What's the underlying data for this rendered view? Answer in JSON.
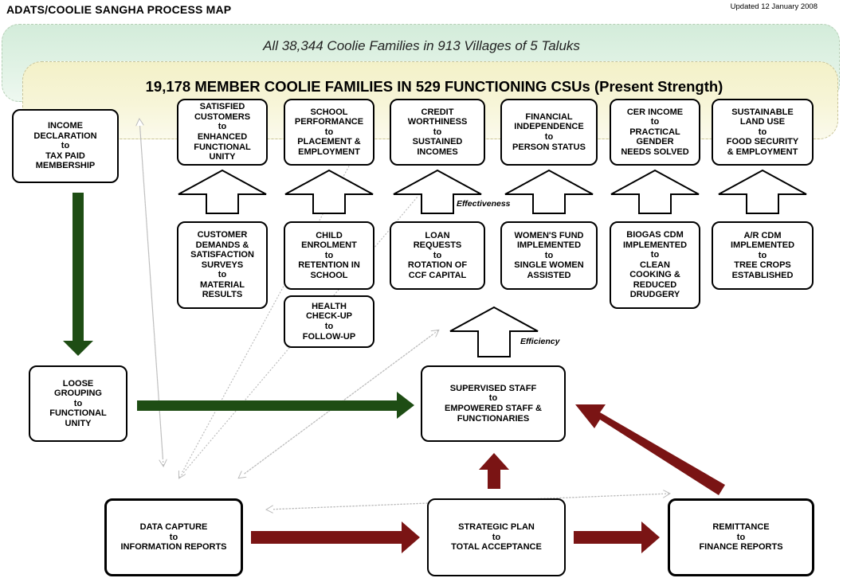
{
  "header": {
    "title": "ADATS/COOLIE SANGHA PROCESS MAP",
    "updated": "Updated 12 January 2008"
  },
  "bands": {
    "outer": "All 38,344 Coolie Families in 913 Villages of 5 Taluks",
    "inner": "19,178 MEMBER COOLIE FAMILIES IN 529 FUNCTIONING CSUs (Present Strength)"
  },
  "colors": {
    "green_arrow": "#1e4d14",
    "red_arrow": "#7a1414",
    "outer_band": "#d9efdf",
    "inner_band": "#f5f3d0"
  },
  "outcomes": [
    "SATISFIED\nCUSTOMERS\nto\nENHANCED\nFUNCTIONAL\nUNITY",
    "SCHOOL\nPERFORMANCE\nto\nPLACEMENT &\nEMPLOYMENT",
    "CREDIT\nWORTHINESS\nto\nSUSTAINED\nINCOMES",
    "FINANCIAL\nINDEPENDENCE\nto\nPERSON STATUS",
    "CER INCOME\nto\nPRACTICAL\nGENDER\nNEEDS SOLVED",
    "SUSTAINABLE\nLAND USE\nto\nFOOD SECURITY\n& EMPLOYMENT"
  ],
  "activities": [
    "CUSTOMER\nDEMANDS &\nSATISFACTION\nSURVEYS\nto\nMATERIAL\nRESULTS",
    "CHILD\nENROLMENT\nto\nRETENTION IN\nSCHOOL",
    "LOAN\nREQUESTS\nto\nROTATION OF\nCCF CAPITAL",
    "WOMEN'S FUND\nIMPLEMENTED\nto\nSINGLE WOMEN\nASSISTED",
    "BIOGAS CDM\nIMPLEMENTED\nto\nCLEAN\nCOOKING &\nREDUCED\nDRUDGERY",
    "A/R CDM\nIMPLEMENTED\nto\nTREE CROPS\nESTABLISHED"
  ],
  "health": "HEALTH\nCHECK-UP\nto\nFOLLOW-UP",
  "income_declaration": "INCOME\nDECLARATION\nto\nTAX PAID\nMEMBERSHIP",
  "loose_grouping": "LOOSE\nGROUPING\nto\nFUNCTIONAL\nUNITY",
  "supervised_staff": "SUPERVISED STAFF\nto\nEMPOWERED STAFF &\nFUNCTIONARIES",
  "data_capture": "DATA CAPTURE\nto\nINFORMATION REPORTS",
  "strategic_plan": "STRATEGIC PLAN\nto\nTOTAL ACCEPTANCE",
  "remittance": "REMITTANCE\nto\nFINANCE REPORTS",
  "labels": {
    "effectiveness": "Effectiveness",
    "efficiency": "Efficiency"
  }
}
